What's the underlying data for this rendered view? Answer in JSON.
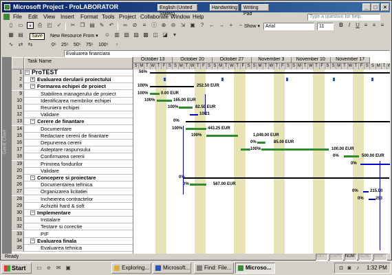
{
  "window": {
    "title": "Microsoft Project - ProLABORATOR",
    "language": "English (United States)",
    "handwriting": "Handwriting",
    "writing_pad": "Writing Pad",
    "buttons": [
      "_",
      "□",
      "×"
    ]
  },
  "menu": [
    "File",
    "Edit",
    "View",
    "Insert",
    "Format",
    "Tools",
    "Project",
    "Collaborate",
    "Window",
    "Help"
  ],
  "ask_placeholder": "Type a question for help",
  "toolbar": {
    "save_tooltip": "Save",
    "show_label": "Show ▾",
    "font": "Arial",
    "size": "11",
    "new_resource": "New Resource From ▾",
    "zoom_labels": [
      "0⁵",
      "25⁵",
      "50⁵",
      "75⁵",
      "100⁵"
    ]
  },
  "entry_value": "Evaluarea financiara",
  "view_bar": "Gantt Chart",
  "grid": {
    "col_header": "Task Name"
  },
  "tasks": [
    {
      "id": "1",
      "name": "ProTEST",
      "level": 0,
      "summary": true,
      "exp": "−"
    },
    {
      "id": "2",
      "name": "Evaluarea derularii proiectului",
      "level": 1,
      "summary": true,
      "exp": "+"
    },
    {
      "id": "8",
      "name": "Formarea echipei de proiect",
      "level": 1,
      "summary": true,
      "exp": "−"
    },
    {
      "id": "9",
      "name": "Stabilirea managerului de proiect",
      "level": 2,
      "summary": false
    },
    {
      "id": "10",
      "name": "Identificarea membrilor echipei",
      "level": 2,
      "summary": false
    },
    {
      "id": "11",
      "name": "Reuniera echipei",
      "level": 2,
      "summary": false
    },
    {
      "id": "12",
      "name": "Validare",
      "level": 2,
      "summary": false
    },
    {
      "id": "13",
      "name": "Cerere de finantare",
      "level": 1,
      "summary": true,
      "exp": "−"
    },
    {
      "id": "14",
      "name": "Documentare",
      "level": 2,
      "summary": false
    },
    {
      "id": "15",
      "name": "Redactare cererii de finantare",
      "level": 2,
      "summary": false
    },
    {
      "id": "16",
      "name": "Depunerea cererii",
      "level": 2,
      "summary": false
    },
    {
      "id": "17",
      "name": "Asteptare raspunsului",
      "level": 2,
      "summary": false
    },
    {
      "id": "18",
      "name": "Confirmarea cererii",
      "level": 2,
      "summary": false
    },
    {
      "id": "19",
      "name": "Primirea fondurilor",
      "level": 2,
      "summary": false
    },
    {
      "id": "20",
      "name": "Validare",
      "level": 2,
      "summary": false
    },
    {
      "id": "25",
      "name": "Concepere si proiectare",
      "level": 1,
      "summary": true,
      "exp": "−"
    },
    {
      "id": "26",
      "name": "Documentarea tehnica",
      "level": 2,
      "summary": false
    },
    {
      "id": "27",
      "name": "Organizarea licitatiei",
      "level": 2,
      "summary": false
    },
    {
      "id": "28",
      "name": "Incheierea contractelor",
      "level": 2,
      "summary": false
    },
    {
      "id": "29",
      "name": "Achizitii hard & soft",
      "level": 2,
      "summary": false
    },
    {
      "id": "30",
      "name": "Implementare",
      "level": 1,
      "summary": true,
      "exp": "−"
    },
    {
      "id": "31",
      "name": "Instalare",
      "level": 2,
      "summary": false
    },
    {
      "id": "32",
      "name": "Testare si corectie",
      "level": 2,
      "summary": false
    },
    {
      "id": "33",
      "name": "PIF",
      "level": 2,
      "summary": false
    },
    {
      "id": "34",
      "name": "Evaluarea finala",
      "level": 1,
      "summary": true,
      "exp": "−"
    },
    {
      "id": "35",
      "name": "Evaluarea tehnica",
      "level": 2,
      "summary": false
    }
  ],
  "gantt": {
    "weeks": [
      "October 13",
      "October 20",
      "October 27",
      "November 3",
      "November 10",
      "November 17"
    ],
    "days": [
      "S",
      "M",
      "T",
      "W",
      "T",
      "F",
      "S"
    ],
    "labels": [
      "56%",
      "100%",
      "252.50 EUR",
      "100%",
      "0.00 EUR",
      "100%",
      "165.00 EUR",
      "100%",
      "82.50 EUR",
      "10/21",
      "0%",
      "100%",
      "443.25 EUR",
      "100%",
      "1,049.00 EUR",
      "0%",
      "85.00 EUR",
      "100%",
      "100.00 EUR",
      "0%",
      "500.00 EUR",
      "0%",
      "0%",
      "0%",
      "567.00 EUR",
      "0%",
      "215.00",
      "0%",
      "253"
    ],
    "colors": {
      "actual": "#2e8b2e",
      "planned": "#0000cc",
      "summary": "#000000",
      "shade": "#e6e4b4"
    }
  },
  "status": {
    "left": "Ready",
    "indicators": [
      "EXT",
      "CAPS",
      "NUM",
      "SCRL",
      "OVR"
    ]
  },
  "taskbar": {
    "start": "Start",
    "buttons": [
      "Exploring...",
      "Microsoft...",
      "Find: File...",
      "Microso..."
    ],
    "clock": "1:32 PM"
  }
}
